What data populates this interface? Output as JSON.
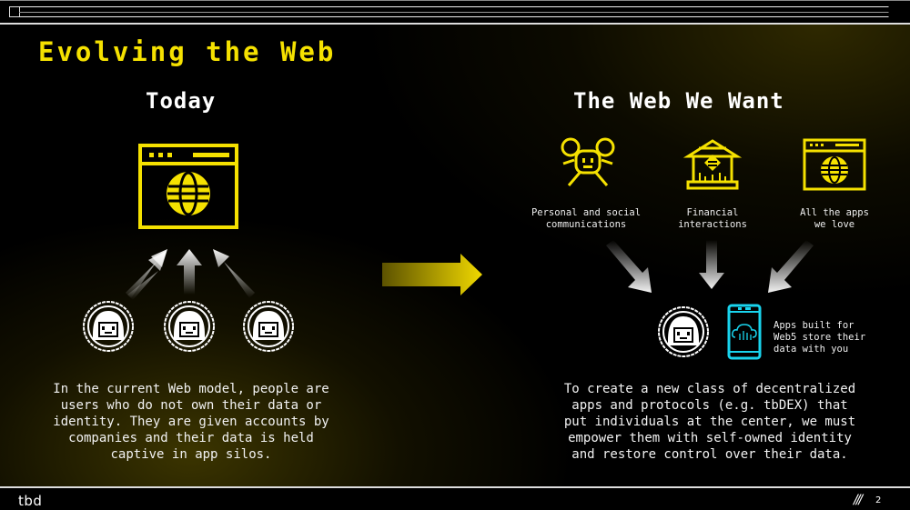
{
  "slide": {
    "title": "Evolving the Web",
    "page_number": "2",
    "page_mark": "///",
    "logo": "tbd"
  },
  "colors": {
    "accent_yellow": "#f5e100",
    "accent_cyan": "#19d4ee",
    "background": "#000000",
    "text": "#ffffff"
  },
  "left": {
    "heading": "Today",
    "icon": "browser-globe-icon",
    "users": [
      "user-avatar-icon",
      "user-avatar-icon",
      "user-avatar-icon"
    ],
    "description": [
      "In the current Web model, people are",
      "users who do not own their data or",
      "identity. They are given accounts by",
      "companies and their data is held",
      "captive in app silos."
    ]
  },
  "transition": {
    "icon": "arrow-right-icon"
  },
  "right": {
    "heading": "The Web We Want",
    "categories": [
      {
        "icon": "social-people-icon",
        "label_lines": [
          "Personal and social",
          "communications"
        ]
      },
      {
        "icon": "bank-icon",
        "label_lines": [
          "Financial",
          "interactions"
        ]
      },
      {
        "icon": "browser-globe-icon",
        "label_lines": [
          "All the apps",
          "we love"
        ]
      }
    ],
    "center": {
      "user_icon": "user-avatar-icon",
      "device_icon": "phone-cloud-icon",
      "note_lines": [
        "Apps built for",
        "Web5 store their",
        "data with you"
      ]
    },
    "description": [
      "To create a new class of decentralized",
      "apps and protocols (e.g. tbDEX) that",
      "put individuals at the center, we must",
      "empower them with self-owned identity",
      "and restore control over their data."
    ]
  }
}
